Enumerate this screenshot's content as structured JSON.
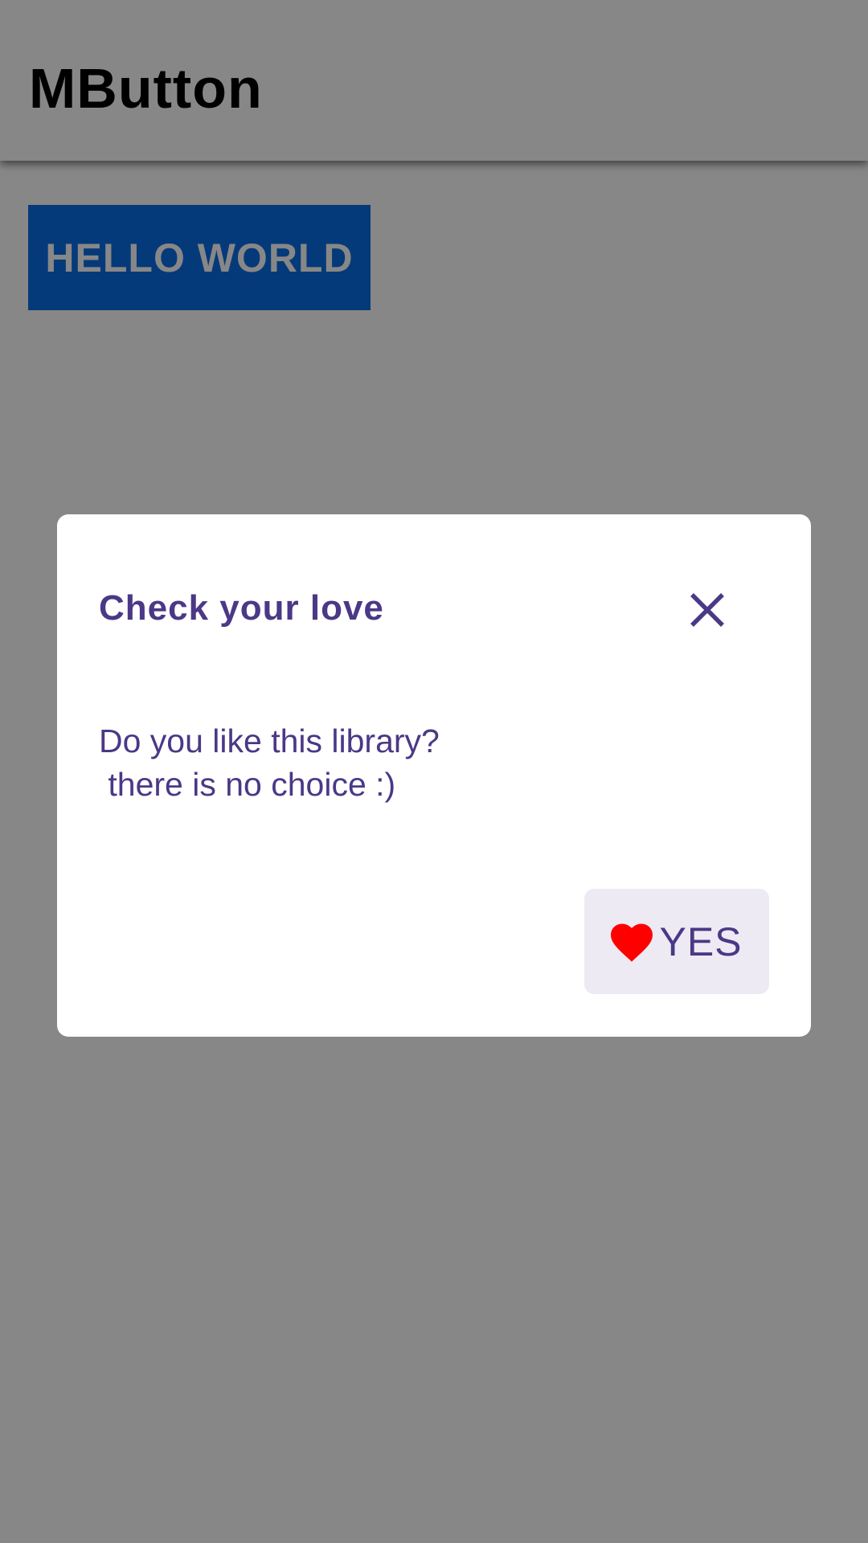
{
  "app_bar": {
    "title": "MButton"
  },
  "main": {
    "hello_button_label": "HELLO WORLD"
  },
  "dialog": {
    "title": "Check your love",
    "body_line1": "Do you like this library?",
    "body_line2": " there is no choice :)",
    "close_icon": "close-icon",
    "yes_button": {
      "icon": "heart-icon",
      "label": "YES"
    }
  },
  "colors": {
    "accent": "#4b3886",
    "primary_button": "#0a6fe6",
    "heart": "#ff0000",
    "yes_button_bg": "#eeeaf4",
    "scrim": "rgba(0,0,0,0.47)"
  }
}
